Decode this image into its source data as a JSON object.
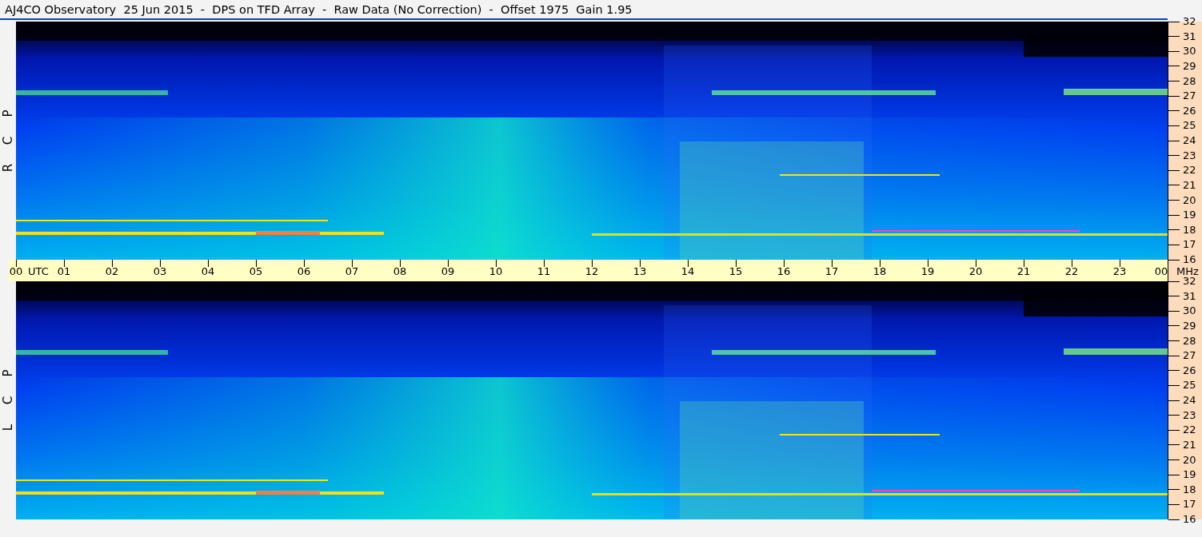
{
  "title": "AJ4CO Observatory  25 Jun 2015  -  DPS on TFD Array  -  Raw Data (No Correction)  -  Offset 1975  Gain 1.95",
  "panels": [
    {
      "letters": [
        "R",
        "C",
        "P"
      ],
      "freq_ticks": [
        "32",
        "31",
        "30",
        "29",
        "28",
        "27",
        "26",
        "25",
        "24",
        "23",
        "22",
        "21",
        "20",
        "19",
        "18",
        "17",
        "16"
      ]
    },
    {
      "letters": [
        "L",
        "C",
        "P"
      ],
      "freq_ticks": [
        "32",
        "31",
        "30",
        "29",
        "28",
        "27",
        "26",
        "25",
        "24",
        "23",
        "22",
        "21",
        "20",
        "19",
        "18",
        "17",
        "16"
      ]
    }
  ],
  "time_axis": {
    "labels": [
      "00",
      "01",
      "02",
      "03",
      "04",
      "05",
      "06",
      "07",
      "08",
      "09",
      "10",
      "11",
      "12",
      "13",
      "14",
      "15",
      "16",
      "17",
      "18",
      "19",
      "20",
      "21",
      "22",
      "23",
      "00"
    ],
    "start_unit": "UTC",
    "end_unit": "MHz"
  }
}
